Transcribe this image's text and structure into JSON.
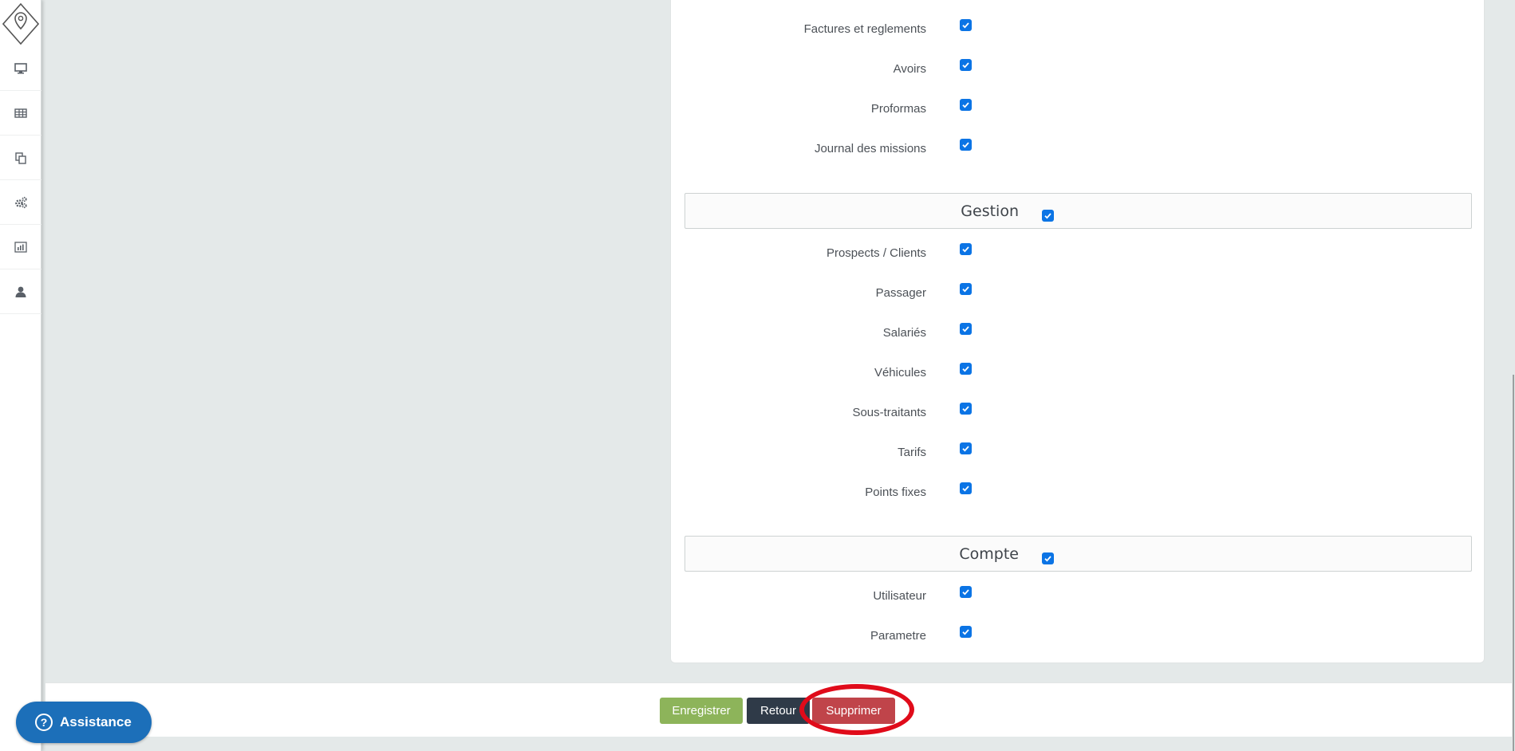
{
  "sidebar": {
    "items": [
      {
        "icon": "monitor-icon"
      },
      {
        "icon": "table-icon"
      },
      {
        "icon": "copy-icon"
      },
      {
        "icon": "gears-icon"
      },
      {
        "icon": "bar-chart-icon"
      },
      {
        "icon": "user-icon"
      }
    ]
  },
  "permissions": {
    "top_items": [
      {
        "label": "Factures et reglements",
        "checked": true
      },
      {
        "label": "Avoirs",
        "checked": true
      },
      {
        "label": "Proformas",
        "checked": true
      },
      {
        "label": "Journal des missions",
        "checked": true
      }
    ],
    "gestion": {
      "title": "Gestion",
      "checked": true,
      "items": [
        {
          "label": "Prospects / Clients",
          "checked": true
        },
        {
          "label": "Passager",
          "checked": true
        },
        {
          "label": "Salariés",
          "checked": true
        },
        {
          "label": "Véhicules",
          "checked": true
        },
        {
          "label": "Sous-traitants",
          "checked": true
        },
        {
          "label": "Tarifs",
          "checked": true
        },
        {
          "label": "Points fixes",
          "checked": true
        }
      ]
    },
    "compte": {
      "title": "Compte",
      "checked": true,
      "items": [
        {
          "label": "Utilisateur",
          "checked": true
        },
        {
          "label": "Parametre",
          "checked": true
        }
      ]
    }
  },
  "actions": {
    "save_label": "Enregistrer",
    "back_label": "Retour",
    "delete_label": "Supprimer"
  },
  "assistance": {
    "label": "Assistance",
    "icon": "question-icon"
  },
  "colors": {
    "save": "#8db45a",
    "back": "#2f3a48",
    "delete": "#c0444a",
    "checkbox": "#0b74e5",
    "assistance": "#1c6fb9",
    "highlight": "#e00b1a"
  }
}
